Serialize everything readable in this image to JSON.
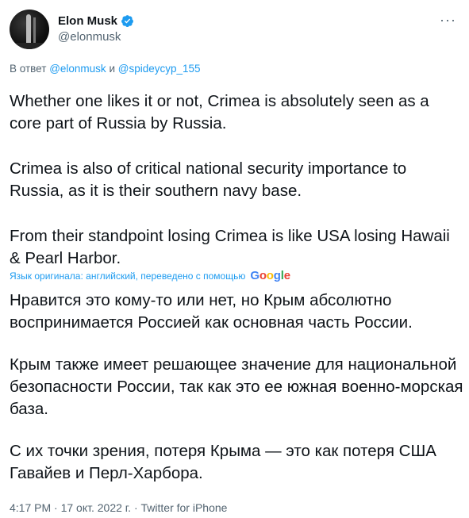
{
  "author": {
    "display_name": "Elon Musk",
    "handle": "@elonmusk"
  },
  "reply": {
    "prefix": "В ответ",
    "mention1": "@elonmusk",
    "conjunction": "и",
    "mention2": "@spideycyp_155"
  },
  "tweet": {
    "paragraphs": [
      "Whether one likes it or not, Crimea is absolutely seen as a core part of Russia by Russia.",
      "Crimea is also of critical national security importance to Russia, as it is their southern navy base.",
      "From their standpoint losing Crimea is like USA losing Hawaii & Pearl Harbor."
    ]
  },
  "translation": {
    "label": "Язык оригинала: английский, переведено с помощью",
    "provider": "Google",
    "paragraphs": [
      "Нравится это кому-то или нет, но Крым абсолютно воспринимается Россией как основная часть России.",
      "Крым также имеет решающее значение для национальной безопасности России, так как это ее южная военно-морская база.",
      "С их точки зрения, потеря Крыма — это как потеря США Гавайев и Перл-Харбора."
    ]
  },
  "meta": {
    "text": "4:17 PM · 17 окт. 2022 г. · Twitter for iPhone"
  },
  "colors": {
    "accent": "#1d9bf0",
    "secondary_text": "#536471",
    "primary_text": "#0f1419"
  },
  "icons": {
    "verified": "verified-badge-icon",
    "more": "more-horizontal-icon"
  }
}
